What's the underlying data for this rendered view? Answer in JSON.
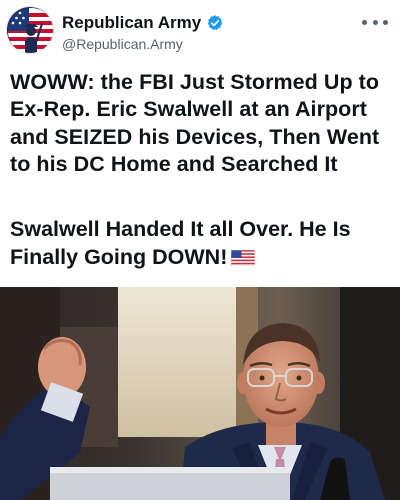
{
  "account": {
    "display_name": "Republican Army",
    "handle": "@Republican.Army",
    "avatar_icon": "minuteman-flag-avatar-icon",
    "verified_icon": "verified-badge-icon",
    "verified_color": "#1d9bf0",
    "more_icon": "more-options-icon"
  },
  "post": {
    "headline": "WOWW: the FBI Just Stormed Up to Ex-Rep. Eric Swalwell at an Airport and SEIZED his Devices, Then Went to his DC Home and Searched It",
    "subline": "Swalwell Handed It all Over. He Is Finally Going DOWN!",
    "emoji_icon": "us-flag-icon"
  },
  "media": {
    "photo_icon": "man-in-suit-photo"
  }
}
